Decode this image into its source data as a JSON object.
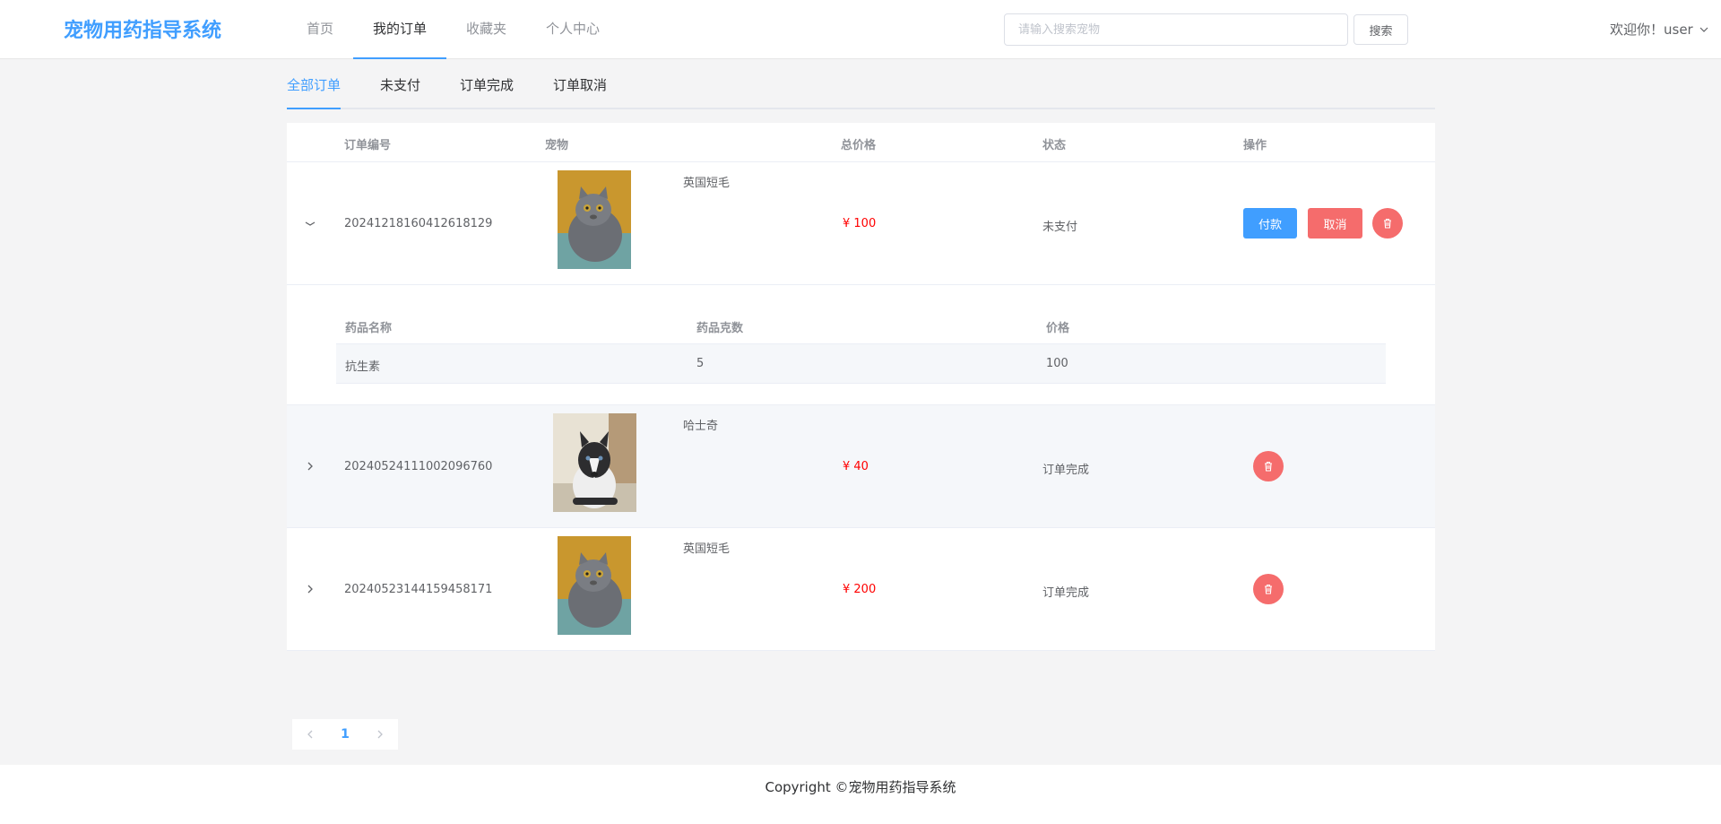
{
  "header": {
    "logo": "宠物用药指导系统",
    "nav": [
      {
        "label": "首页",
        "active": false
      },
      {
        "label": "我的订单",
        "active": true
      },
      {
        "label": "收藏夹",
        "active": false
      },
      {
        "label": "个人中心",
        "active": false
      }
    ],
    "search_placeholder": "请输入搜索宠物",
    "search_button": "搜索",
    "welcome": "欢迎你！user"
  },
  "tabs": [
    {
      "label": "全部订单",
      "active": true
    },
    {
      "label": "未支付",
      "active": false
    },
    {
      "label": "订单完成",
      "active": false
    },
    {
      "label": "订单取消",
      "active": false
    }
  ],
  "table": {
    "headers": {
      "order_no": "订单编号",
      "pet": "宠物",
      "total": "总价格",
      "status": "状态",
      "action": "操作"
    },
    "rows": [
      {
        "order_no": "20241218160412618129",
        "pet_name": "英国短毛",
        "price": "¥ 100",
        "status": "未支付",
        "pay_label": "付款",
        "cancel_label": "取消",
        "expanded": true,
        "image": "gray-cat"
      },
      {
        "order_no": "20240524111002096760",
        "pet_name": "哈士奇",
        "price": "¥ 40",
        "status": "订单完成",
        "expanded": false,
        "image": "husky"
      },
      {
        "order_no": "20240523144159458171",
        "pet_name": "英国短毛",
        "price": "¥ 200",
        "status": "订单完成",
        "expanded": false,
        "image": "gray-cat"
      }
    ],
    "detail": {
      "headers": {
        "name": "药品名称",
        "grams": "药品克数",
        "price": "价格"
      },
      "rows": [
        {
          "name": "抗生素",
          "grams": "5",
          "price": "100"
        }
      ]
    }
  },
  "pagination": {
    "current": "1"
  },
  "footer": "Copyright ©宠物用药指导系统",
  "colors": {
    "accent": "#409eff",
    "danger": "#f56c6c",
    "price": "#ff0000"
  }
}
